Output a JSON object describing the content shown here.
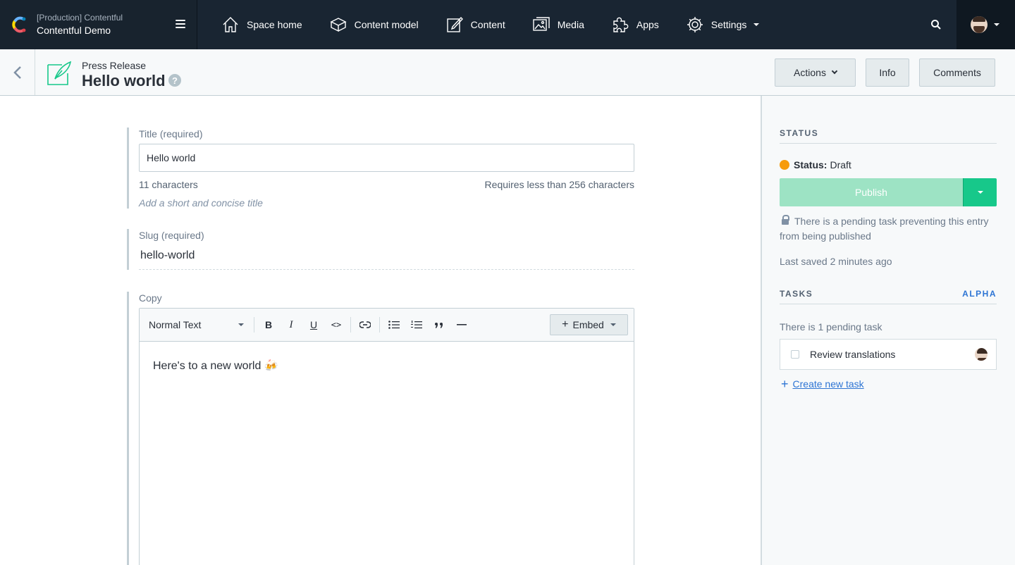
{
  "topnav": {
    "space_env": "[Production] Contentful",
    "space_name": "Contentful Demo",
    "links": [
      {
        "label": "Space home",
        "icon": "home-icon"
      },
      {
        "label": "Content model",
        "icon": "content-model-icon"
      },
      {
        "label": "Content",
        "icon": "content-icon"
      },
      {
        "label": "Media",
        "icon": "media-icon"
      },
      {
        "label": "Apps",
        "icon": "apps-icon"
      },
      {
        "label": "Settings",
        "icon": "gear-icon"
      }
    ]
  },
  "entry": {
    "content_type": "Press Release",
    "title": "Hello world",
    "help_glyph": "?",
    "actions_label": "Actions",
    "info_label": "Info",
    "comments_label": "Comments"
  },
  "fields": {
    "title": {
      "label": "Title (required)",
      "value": "Hello world",
      "count": "11 characters",
      "limit": "Requires less than 256 characters",
      "hint": "Add a short and concise title"
    },
    "slug": {
      "label": "Slug (required)",
      "value": "hello-world"
    },
    "copy": {
      "label": "Copy",
      "style": "Normal Text",
      "bold": "B",
      "italic": "I",
      "underline": "U",
      "code": "<>",
      "embed": "Embed",
      "embed_plus": "+",
      "body": "Here's to a new world 🍻"
    }
  },
  "sidebar": {
    "status_title": "STATUS",
    "status_label": "Status:",
    "status_value": "Draft",
    "publish_label": "Publish",
    "lock_message": "There is a pending task preventing this entry from being published",
    "last_saved": "Last saved 2 minutes ago",
    "tasks_title": "TASKS",
    "tasks_badge": "ALPHA",
    "pending_text": "There is 1 pending task",
    "task_label": "Review translations",
    "create_plus": "+",
    "create_label": "Create new task"
  },
  "colors": {
    "nav_bg": "#192532",
    "status_draft": "#f79b0c",
    "publish_disabled": "#9de3c4",
    "publish_accent": "#17c88a",
    "link": "#2e75d4"
  }
}
